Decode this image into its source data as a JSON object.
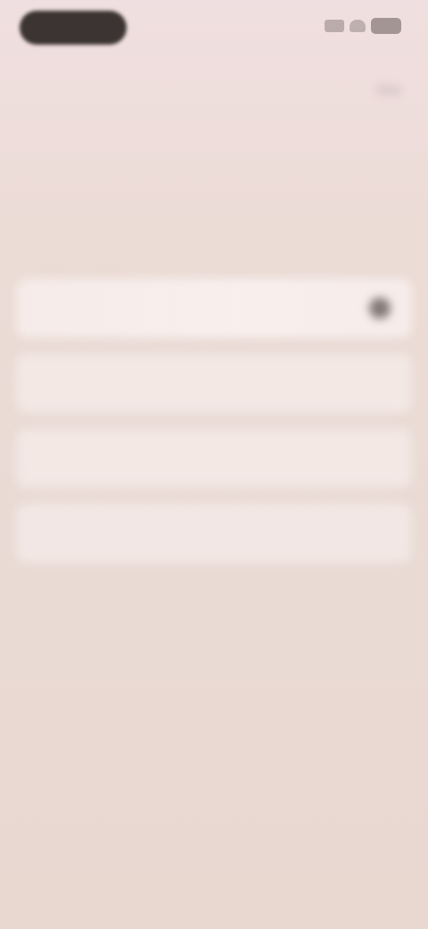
{
  "status_bar": {
    "time": "",
    "icons": [
      "signal-icon",
      "wifi-icon",
      "battery-icon"
    ]
  },
  "header": {
    "skip_label": "Skip"
  },
  "main": {
    "headline": "",
    "subtitle": ""
  },
  "options": [
    {
      "label": "",
      "selected": true,
      "icon": "close-icon"
    },
    {
      "label": "",
      "selected": false
    },
    {
      "label": "",
      "selected": false
    },
    {
      "label": "",
      "selected": false
    }
  ],
  "colors": {
    "background_top": "#f0dfe0",
    "background_bottom": "#e9d8d0",
    "pill": "#3b3432",
    "card": "#f8efed",
    "text": "#4a3f3c"
  }
}
